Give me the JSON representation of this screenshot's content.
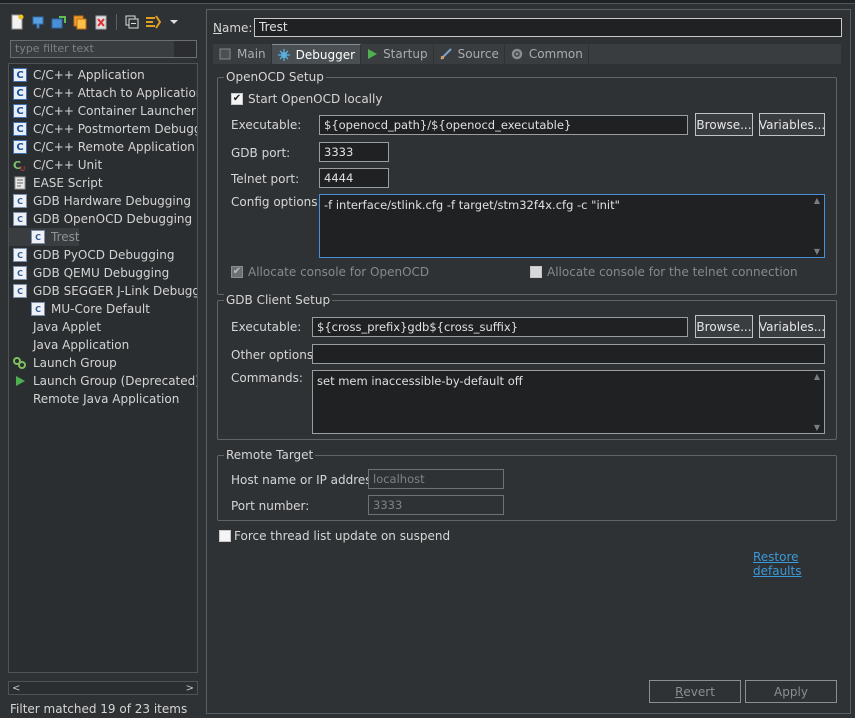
{
  "toolbar": {
    "icons": [
      "new-config-icon",
      "new-prototype-icon",
      "export-icon",
      "duplicate-icon",
      "delete-icon",
      "collapse-all-icon",
      "filter-icon",
      "view-menu-chevron-icon"
    ]
  },
  "filter": {
    "placeholder": "type filter text"
  },
  "tree": {
    "items": [
      {
        "label": "C/C++ Application",
        "icon": "c-app-icon",
        "indent": 0
      },
      {
        "label": "C/C++ Attach to Application",
        "icon": "c-app-icon",
        "indent": 0
      },
      {
        "label": "C/C++ Container Launcher",
        "icon": "c-app-icon",
        "indent": 0
      },
      {
        "label": "C/C++ Postmortem Debugger",
        "icon": "c-app-icon",
        "indent": 0
      },
      {
        "label": "C/C++ Remote Application",
        "icon": "c-app-icon",
        "indent": 0
      },
      {
        "label": "C/C++ Unit",
        "icon": "c-unit-icon",
        "indent": 0
      },
      {
        "label": "EASE Script",
        "icon": "script-icon",
        "indent": 0
      },
      {
        "label": "GDB Hardware Debugging",
        "icon": "c-small-icon",
        "indent": 0
      },
      {
        "label": "GDB OpenOCD Debugging",
        "icon": "c-small-icon",
        "indent": 0
      },
      {
        "label": "Trest",
        "icon": "c-small-icon",
        "indent": 1,
        "selected": true
      },
      {
        "label": "GDB PyOCD Debugging",
        "icon": "c-small-icon",
        "indent": 0
      },
      {
        "label": "GDB QEMU Debugging",
        "icon": "c-small-icon",
        "indent": 0
      },
      {
        "label": "GDB SEGGER J-Link Debugging",
        "icon": "c-small-icon",
        "indent": 0
      },
      {
        "label": "MU-Core Default",
        "icon": "c-small-icon",
        "indent": 1
      },
      {
        "label": "Java Applet",
        "icon": "none",
        "indent": 0
      },
      {
        "label": "Java Application",
        "icon": "none",
        "indent": 0
      },
      {
        "label": "Launch Group",
        "icon": "launch-group-icon",
        "indent": 0
      },
      {
        "label": "Launch Group (Deprecated)",
        "icon": "launch-group-deprecated-icon",
        "indent": 0
      },
      {
        "label": "Remote Java Application",
        "icon": "none",
        "indent": 0
      }
    ]
  },
  "status": {
    "text": "Filter matched 19 of 23 items"
  },
  "name": {
    "label": "Name:",
    "value": "Trest"
  },
  "tabs": [
    {
      "label": "Main",
      "icon": "main-tab-icon",
      "active": false
    },
    {
      "label": "Debugger",
      "icon": "debugger-tab-icon",
      "active": true
    },
    {
      "label": "Startup",
      "icon": "startup-tab-icon",
      "active": false
    },
    {
      "label": "Source",
      "icon": "source-tab-icon",
      "active": false
    },
    {
      "label": "Common",
      "icon": "common-tab-icon",
      "active": false
    }
  ],
  "openocd": {
    "title": "OpenOCD Setup",
    "start_locally": "Start OpenOCD locally",
    "executable_label": "Executable:",
    "executable_value": "${openocd_path}/${openocd_executable}",
    "browse": "Browse...",
    "variables": "Variables...",
    "gdb_port_label": "GDB port:",
    "gdb_port_value": "3333",
    "telnet_port_label": "Telnet port:",
    "telnet_port_value": "4444",
    "config_label": "Config options:",
    "config_value": "-f interface/stlink.cfg -f target/stm32f4x.cfg -c \"init\"",
    "alloc_console": "Allocate console for OpenOCD",
    "alloc_telnet": "Allocate console for the telnet connection"
  },
  "gdb_client": {
    "title": "GDB Client Setup",
    "executable_label": "Executable:",
    "executable_value": "${cross_prefix}gdb${cross_suffix}",
    "browse": "Browse...",
    "variables": "Variables...",
    "other_label": "Other options:",
    "other_value": "",
    "commands_label": "Commands:",
    "commands_value": "set mem inaccessible-by-default off"
  },
  "remote": {
    "title": "Remote Target",
    "host_label": "Host name or IP address:",
    "host_value": "localhost",
    "port_label": "Port number:",
    "port_value": "3333"
  },
  "force_thread": "Force thread list update on suspend",
  "restore_defaults": "Restore defaults",
  "buttons": {
    "revert": "Revert",
    "apply": "Apply"
  }
}
